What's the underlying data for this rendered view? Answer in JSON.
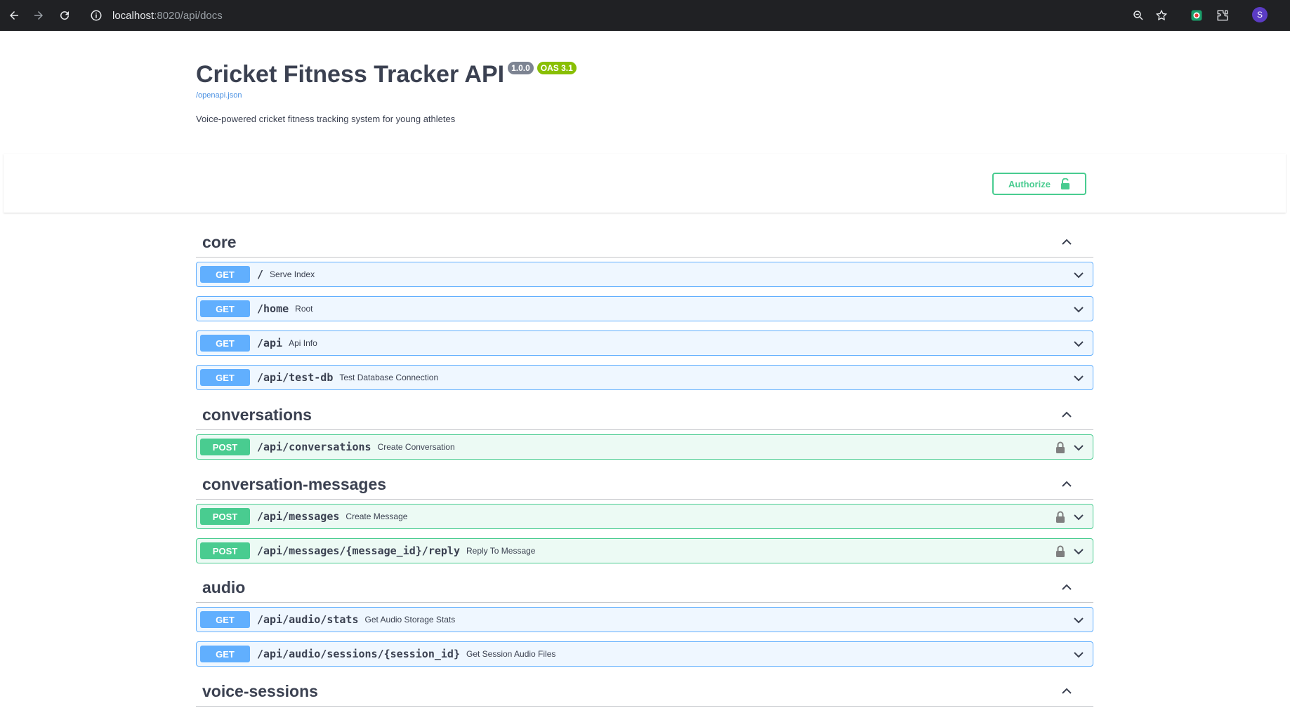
{
  "browser": {
    "url_host": "localhost",
    "url_path": ":8020/api/docs",
    "avatar_letter": "S"
  },
  "info": {
    "title": "Cricket Fitness Tracker API",
    "version": "1.0.0",
    "oas": "OAS 3.1",
    "spec_link": "/openapi.json",
    "description": "Voice-powered cricket fitness tracking system for young athletes"
  },
  "authorize": {
    "label": "Authorize"
  },
  "colors": {
    "get": "#61affe",
    "post": "#49cc90",
    "text": "#3b4151"
  },
  "tags": [
    {
      "name": "core",
      "operations": [
        {
          "method": "GET",
          "path": "/",
          "summary": "Serve Index",
          "locked": false
        },
        {
          "method": "GET",
          "path": "/home",
          "summary": "Root",
          "locked": false
        },
        {
          "method": "GET",
          "path": "/api",
          "summary": "Api Info",
          "locked": false
        },
        {
          "method": "GET",
          "path": "/api/test-db",
          "summary": "Test Database Connection",
          "locked": false
        }
      ]
    },
    {
      "name": "conversations",
      "operations": [
        {
          "method": "POST",
          "path": "/api/conversations",
          "summary": "Create Conversation",
          "locked": true
        }
      ]
    },
    {
      "name": "conversation-messages",
      "operations": [
        {
          "method": "POST",
          "path": "/api/messages",
          "summary": "Create Message",
          "locked": true
        },
        {
          "method": "POST",
          "path": "/api/messages/{message_id}/reply",
          "summary": "Reply To Message",
          "locked": true
        }
      ]
    },
    {
      "name": "audio",
      "operations": [
        {
          "method": "GET",
          "path": "/api/audio/stats",
          "summary": "Get Audio Storage Stats",
          "locked": false
        },
        {
          "method": "GET",
          "path": "/api/audio/sessions/{session_id}",
          "summary": "Get Session Audio Files",
          "locked": false
        }
      ]
    },
    {
      "name": "voice-sessions",
      "operations": []
    }
  ]
}
